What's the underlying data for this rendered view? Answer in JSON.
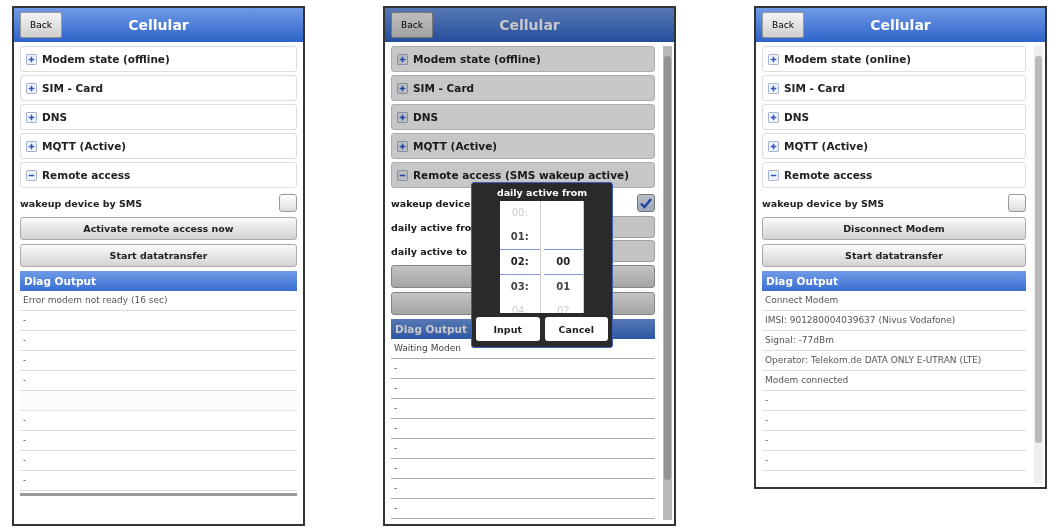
{
  "phones": [
    {
      "back": "Back",
      "title": "Cellular",
      "dimmed": false,
      "scrollable": false,
      "sections": [
        {
          "label": "Modem state (offline)",
          "expanded": false
        },
        {
          "label": "SIM - Card",
          "expanded": false
        },
        {
          "label": "DNS",
          "expanded": false
        },
        {
          "label": "MQTT (Active)",
          "expanded": false
        },
        {
          "label": "Remote access",
          "expanded": true
        }
      ],
      "controls": [
        {
          "kind": "checkbox",
          "label": "wakeup device by SMS",
          "checked": false
        },
        {
          "kind": "button",
          "label": "Activate remote access now"
        },
        {
          "kind": "button",
          "label": "Start datatransfer"
        }
      ],
      "diag": {
        "title": "Diag Output",
        "lines": [
          {
            "text": "Error modem not ready (16 sec)"
          },
          {
            "text": "-"
          },
          {
            "text": "-"
          },
          {
            "text": "-"
          },
          {
            "text": "-"
          },
          {
            "kind": "blank"
          },
          {
            "text": "-"
          },
          {
            "text": "-"
          },
          {
            "text": "-"
          },
          {
            "text": "-"
          }
        ]
      }
    },
    {
      "back": "Back",
      "title": "Cellular",
      "dimmed": true,
      "scrollable": true,
      "sections": [
        {
          "label": "Modem state (offline)",
          "expanded": false
        },
        {
          "label": "SIM - Card",
          "expanded": false
        },
        {
          "label": "DNS",
          "expanded": false
        },
        {
          "label": "MQTT (Active)",
          "expanded": false
        },
        {
          "label": "Remote access (SMS wakeup active)",
          "expanded": true
        }
      ],
      "controls": [
        {
          "kind": "checkbox",
          "label": "wakeup device",
          "checked": true
        },
        {
          "kind": "field",
          "label": "daily active fro"
        },
        {
          "kind": "field",
          "label": "daily active to"
        },
        {
          "kind": "button"
        },
        {
          "kind": "button"
        }
      ],
      "diag": {
        "title": "Diag Output",
        "lines": [
          {
            "text": "Waiting Moden"
          },
          {
            "text": "-"
          },
          {
            "text": "-"
          },
          {
            "text": "-"
          },
          {
            "text": "-"
          },
          {
            "text": "-"
          },
          {
            "text": "-"
          },
          {
            "text": "-"
          },
          {
            "text": "-"
          }
        ]
      },
      "dialog": {
        "title": "daily active from",
        "columns": [
          {
            "items": [
              {
                "text": "00:",
                "selected": false
              },
              {
                "text": "01:",
                "selected": false
              },
              {
                "text": "02:",
                "selected": true
              },
              {
                "text": "03:",
                "selected": false
              },
              {
                "text": "04:",
                "selected": false
              }
            ]
          },
          {
            "items": [
              {
                "text": "00",
                "selected": true
              },
              {
                "text": "01",
                "selected": false
              },
              {
                "text": "02",
                "selected": false
              }
            ]
          }
        ],
        "buttons": [
          "Input",
          "Cancel"
        ]
      }
    },
    {
      "back": "Back",
      "title": "Cellular",
      "dimmed": false,
      "scrollable": true,
      "sections": [
        {
          "label": "Modem state (online)",
          "expanded": false
        },
        {
          "label": "SIM - Card",
          "expanded": false
        },
        {
          "label": "DNS",
          "expanded": false
        },
        {
          "label": "MQTT (Active)",
          "expanded": false
        },
        {
          "label": "Remote access",
          "expanded": true
        }
      ],
      "controls": [
        {
          "kind": "checkbox",
          "label": "wakeup device by SMS",
          "checked": false
        },
        {
          "kind": "button",
          "label": "Disconnect Modem"
        },
        {
          "kind": "button",
          "label": "Start datatransfer"
        }
      ],
      "diag": {
        "title": "Diag Output",
        "lines": [
          {
            "text": "Connect Modem"
          },
          {
            "text": "IMSI: 901280004039637 (Nivus Vodafone)"
          },
          {
            "text": "Signal: -77dBm"
          },
          {
            "text": "Operator: Telekom.de DATA ONLY E-UTRAN (LTE)"
          },
          {
            "text": "Modem connected"
          },
          {
            "text": "-"
          },
          {
            "text": "-"
          },
          {
            "text": "-"
          },
          {
            "text": "-"
          }
        ]
      }
    }
  ]
}
